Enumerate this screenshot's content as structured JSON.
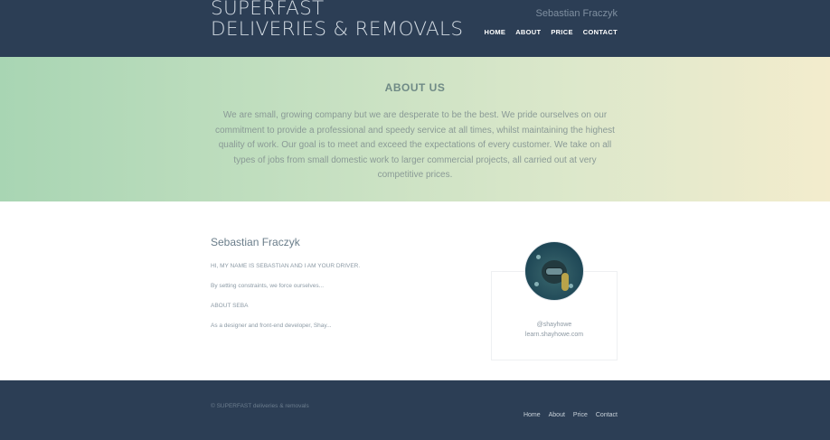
{
  "header": {
    "brand_line1": "SUPERFAST",
    "brand_line2": "DELIVERIES & REMOVALS",
    "user_name": "Sebastian Fraczyk",
    "nav": [
      "HOME",
      "ABOUT",
      "PRICE",
      "CONTACT"
    ]
  },
  "about": {
    "title": "ABOUT US",
    "text": "We are small, growing company but we are desperate to be the best. We pride ourselves on our commitment to provide a professional and speedy service at all times, whilst maintaining the highest quality of work. Our goal is to meet and exceed the expectations of every customer. We take on all types of jobs from small domestic work to larger commercial projects, all carried out at very competitive prices."
  },
  "profile": {
    "name": "Sebastian Fraczyk",
    "intro": "HI, MY NAME IS SEBASTIAN AND I AM YOUR DRIVER.",
    "line2": "By setting constraints, we force ourselves...",
    "line3": "ABOUT SEBA",
    "line4": "As a designer and front-end developer, Shay..."
  },
  "card": {
    "avatar_icon": "diver-avatar",
    "handle": "@shayhowe",
    "url": "learn.shayhowe.com"
  },
  "footer": {
    "copyright": "© SUPERFAST deliveries & removals",
    "nav": [
      "Home",
      "About",
      "Price",
      "Contact"
    ]
  },
  "colors": {
    "header_bg": "#2c3e55",
    "gradient_start": "#a8d5b3",
    "gradient_end": "#f3eccd"
  }
}
